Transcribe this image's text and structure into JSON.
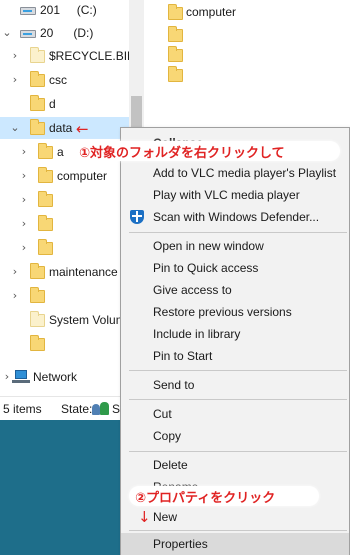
{
  "nav": {
    "drive_c": "201     (C:)",
    "drive_d": "20      (D:)",
    "items": {
      "recycle": "$RECYCLE.BIN",
      "csc": "csc",
      "d": "d",
      "data": "data",
      "a": "a",
      "computer": "computer",
      "maintenance": "maintenance",
      "system_volume": "System Volume"
    },
    "network": "Network"
  },
  "content": {
    "computer": "computer"
  },
  "status": {
    "items_count": "5 items",
    "state_label": "State:",
    "state_text": "Sh"
  },
  "context_menu": {
    "collapse": "Collapse",
    "add_vlc_playlist": "Add to VLC media player's Playlist",
    "play_vlc": "Play with VLC media player",
    "scan_defender": "Scan with Windows Defender...",
    "open_new_window": "Open in new window",
    "pin_quick_access": "Pin to Quick access",
    "give_access": "Give access to",
    "restore_versions": "Restore previous versions",
    "include_library": "Include in library",
    "pin_start": "Pin to Start",
    "send_to": "Send to",
    "cut": "Cut",
    "copy": "Copy",
    "delete": "Delete",
    "rename": "Rename",
    "new": "New",
    "properties": "Properties"
  },
  "annotations": {
    "step1": "①対象のフォルダを右クリックして",
    "arrow_left": "←",
    "step2": "②プロパティをクリック",
    "arrow_down": "↓"
  },
  "colors": {
    "annotation_red": "#e02323",
    "selection_blue": "#cce8ff",
    "desktop_teal": "#1e6e8a",
    "folder_yellow": "#f8d775"
  }
}
